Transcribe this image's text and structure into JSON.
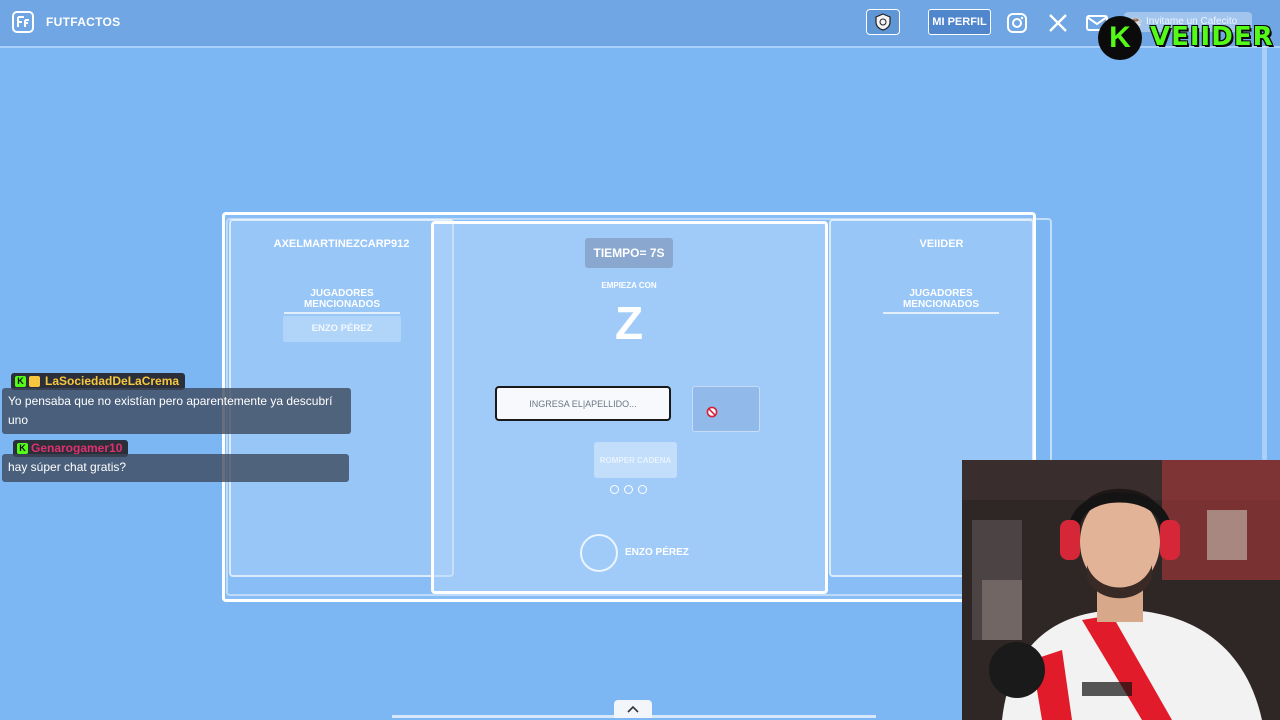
{
  "nav": {
    "brand": "FUTFACTOS",
    "profile_label": "MI PERFIL",
    "cafecito_label": "Invitame un Cafecito",
    "icons": [
      "futfactos-logo-icon",
      "shield-icon",
      "instagram-icon",
      "x-icon",
      "mail-icon",
      "coffee-icon"
    ]
  },
  "stream_overlay": {
    "kick_channel": "VEIIDER",
    "kick_logo_letter": "K",
    "kick_color": "#53fc18"
  },
  "game": {
    "left_player": {
      "name": "AXELMARTINEZCARP912",
      "section_title": "JUGADORES MENCIONADOS",
      "mentioned": [
        "ENZO PÉREZ"
      ]
    },
    "right_player": {
      "name": "VEIIDER",
      "section_title": "JUGADORES MENCIONADOS",
      "mentioned": []
    },
    "timer": "TIEMPO= 7S",
    "starts_with_label": "EMPIEZA CON",
    "letter": "Z",
    "input_value": "INGRESA EL|APELLIDO...",
    "break_chain_label": "ROMPER CADENA",
    "lives_total": 3,
    "current_player": "ENZO PÉREZ"
  },
  "chat": [
    {
      "user": "LaSociedadDeLaCrema",
      "user_color": "#f7c83f",
      "message": "Yo pensaba que no existían pero aparentemente ya descubrí uno"
    },
    {
      "user": "Genarogamer10",
      "user_color": "#e0306f",
      "message": "hay súper chat gratis?"
    }
  ]
}
